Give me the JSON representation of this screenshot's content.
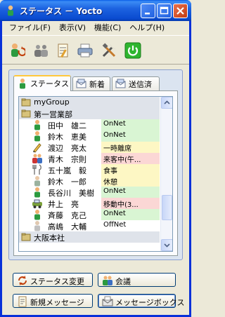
{
  "window": {
    "title": "ステータス － Yocto"
  },
  "menu": [
    "ファイル(F)",
    "表示(V)",
    "機能(C)",
    "ヘルプ(H)"
  ],
  "toolbar": {
    "icons": [
      "users-refresh-icon",
      "group-icon",
      "memo-icon",
      "printer-icon",
      "tools-icon",
      "power-icon"
    ]
  },
  "tabs": [
    {
      "label": "ステータス",
      "icon": "person-icon",
      "active": true
    },
    {
      "label": "新着",
      "icon": "new-mail-icon",
      "active": false
    },
    {
      "label": "送信済",
      "icon": "sent-mail-icon",
      "active": false
    }
  ],
  "list": {
    "rows": [
      {
        "kind": "group",
        "label": "myGroup"
      },
      {
        "kind": "group",
        "label": "第一営業部"
      },
      {
        "kind": "user",
        "name": "田中　雄二",
        "status": "OnNet",
        "icon": "person-online-icon"
      },
      {
        "kind": "user",
        "name": "鈴木　恵美",
        "status": "OnNet",
        "icon": "person-online-icon"
      },
      {
        "kind": "user",
        "name": "渡辺　亮太",
        "status": "一時離席",
        "icon": "pencil-icon"
      },
      {
        "kind": "user",
        "name": "青木　宗則",
        "status": "来客中(午...",
        "icon": "visitor-icon"
      },
      {
        "kind": "user",
        "name": "五十嵐　毅",
        "status": "食事",
        "icon": "meal-icon"
      },
      {
        "kind": "user",
        "name": "鈴木　一郎",
        "status": "休憩",
        "icon": "person-break-icon"
      },
      {
        "kind": "user",
        "name": "長谷川　美樹",
        "status": "OnNet",
        "icon": "person-online-icon"
      },
      {
        "kind": "user",
        "name": "井上　亮",
        "status": "移動中(3...",
        "icon": "vehicle-icon"
      },
      {
        "kind": "user",
        "name": "斉藤　克己",
        "status": "OnNet",
        "icon": "person-online-icon"
      },
      {
        "kind": "user",
        "name": "高嶋　大輔",
        "status": "OffNet",
        "icon": "person-offline-icon"
      },
      {
        "kind": "group",
        "label": "大阪本社"
      }
    ]
  },
  "buttons": {
    "status_change": "ステータス変更",
    "meeting": "会議",
    "new_message": "新規メッセージ",
    "message_box": "メッセージボックス"
  },
  "colors": {
    "title_bar": "#1d63e0",
    "status_online": "#d9f5d3",
    "status_away": "#fdf7c4",
    "status_busy": "#fbd7d5",
    "status_offline": "#ffffff"
  }
}
